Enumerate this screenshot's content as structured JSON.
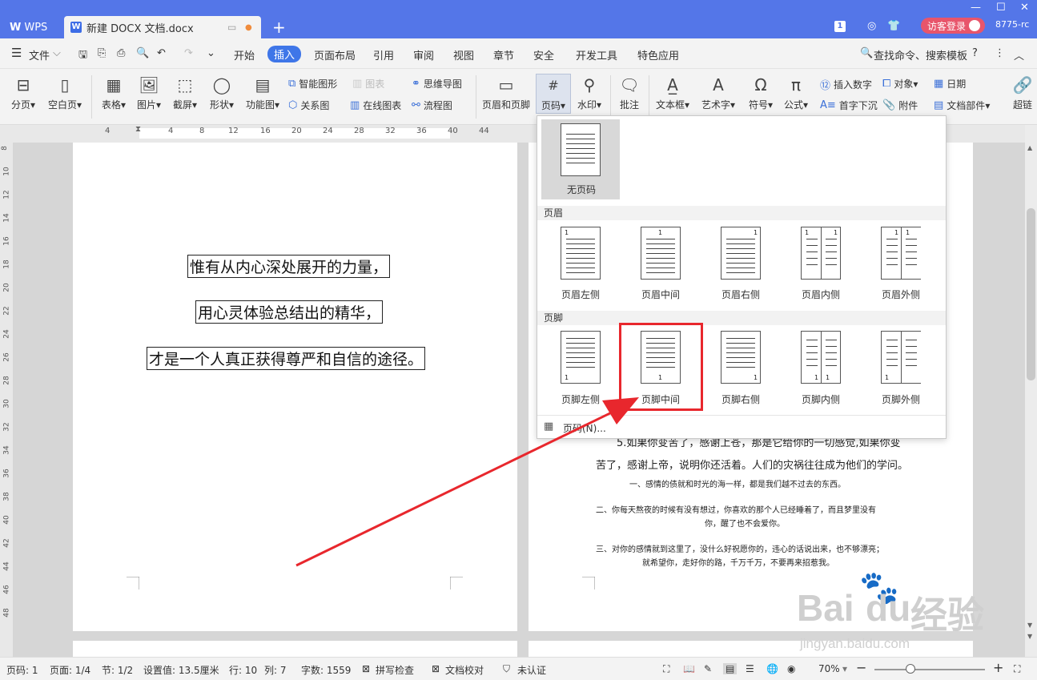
{
  "titlebar": {
    "app_tab": "WPS",
    "doc_tab": "新建 DOCX 文档.docx",
    "new_tab": "+",
    "login": "访客登录",
    "account": "8775-rc",
    "badge": "1"
  },
  "menubar": {
    "file": "文件",
    "items": [
      "开始",
      "插入",
      "页面布局",
      "引用",
      "审阅",
      "视图",
      "章节",
      "安全",
      "开发工具",
      "特色应用"
    ],
    "search": "查找命令、搜索模板"
  },
  "ribbon": {
    "page_break": "分页",
    "blank_page": "空白页",
    "table": "表格",
    "picture": "图片",
    "screenshot": "截屏",
    "shape": "形状",
    "function_chart": "功能图",
    "smart_shape": "智能图形",
    "chart": "图表",
    "mind_map": "思维导图",
    "relation": "关系图",
    "online_chart": "在线图表",
    "flowchart": "流程图",
    "header_footer": "页眉和页脚",
    "page_number": "页码",
    "watermark": "水印",
    "comment": "批注",
    "textbox": "文本框",
    "wordart": "艺术字",
    "symbol": "符号",
    "formula": "公式",
    "insert_number": "插入数字",
    "object": "对象",
    "date": "日期",
    "drop_cap": "首字下沉",
    "attachment": "附件",
    "doc_parts": "文档部件",
    "hyperlink": "超链"
  },
  "ruler_h": [
    "4",
    "4",
    "8",
    "12",
    "16",
    "20",
    "24",
    "28",
    "32",
    "36",
    "40",
    "44"
  ],
  "ruler_v": [
    "8",
    "10",
    "12",
    "14",
    "16",
    "18",
    "20",
    "22",
    "24",
    "26",
    "28",
    "30",
    "32",
    "34",
    "36",
    "38",
    "40",
    "42",
    "44",
    "46",
    "48"
  ],
  "page1": {
    "lines": [
      "惟有从内心深处展开的力量，",
      "用心灵体验总结出的精华，",
      "才是一个人真正获得尊严和自信的途径。"
    ]
  },
  "page2": {
    "line1": "5.如果你变苦了，感谢上苍，那是它给你的一切感觉,如果你变",
    "line2": "苦了，感谢上帝，说明你还活着。人们的灾祸往往成为他们的学问。",
    "p1": "一、感情的债就和时光的海一样，都是我们越不过去的东西。",
    "p2a": "二、你每天熬夜的时候有没有想过，你喜欢的那个人已经睡着了，而且梦里没有",
    "p2b": "你，醒了也不会爱你。",
    "p3a": "三、对你的感情就到这里了，没什么好祝愿你的，违心的话说出来，也不够漂亮；",
    "p3b": "就希望你，走好你的路，千万千万，不要再来招惹我。"
  },
  "dropdown": {
    "none_label": "无页码",
    "header_section": "页眉",
    "footer_section": "页脚",
    "header_items": [
      "页眉左侧",
      "页眉中间",
      "页眉右侧",
      "页眉内侧",
      "页眉外侧"
    ],
    "footer_items": [
      "页脚左侧",
      "页脚中间",
      "页脚右侧",
      "页脚内侧",
      "页脚外侧"
    ],
    "page_number_dialog": "页码(N)...",
    "thumb_number": "1"
  },
  "statusbar": {
    "page_no": "页码: 1",
    "pages": "页面: 1/4",
    "section": "节: 1/2",
    "setting": "设置值: 13.5厘米",
    "row": "行: 10",
    "col": "列: 7",
    "word_count": "字数: 1559",
    "spell_check": "拼写检查",
    "doc_proof": "文档校对",
    "uncertified": "未认证",
    "zoom": "70%"
  },
  "watermark": {
    "brand": "Bai",
    "brand2": "du",
    "brand3": "经验",
    "url": "jingyan.baidu.com"
  },
  "colors": {
    "titlebar": "#5476e8",
    "accent": "#3f76e8",
    "highlight": "#e8272d",
    "arrow": "#e8272d"
  }
}
